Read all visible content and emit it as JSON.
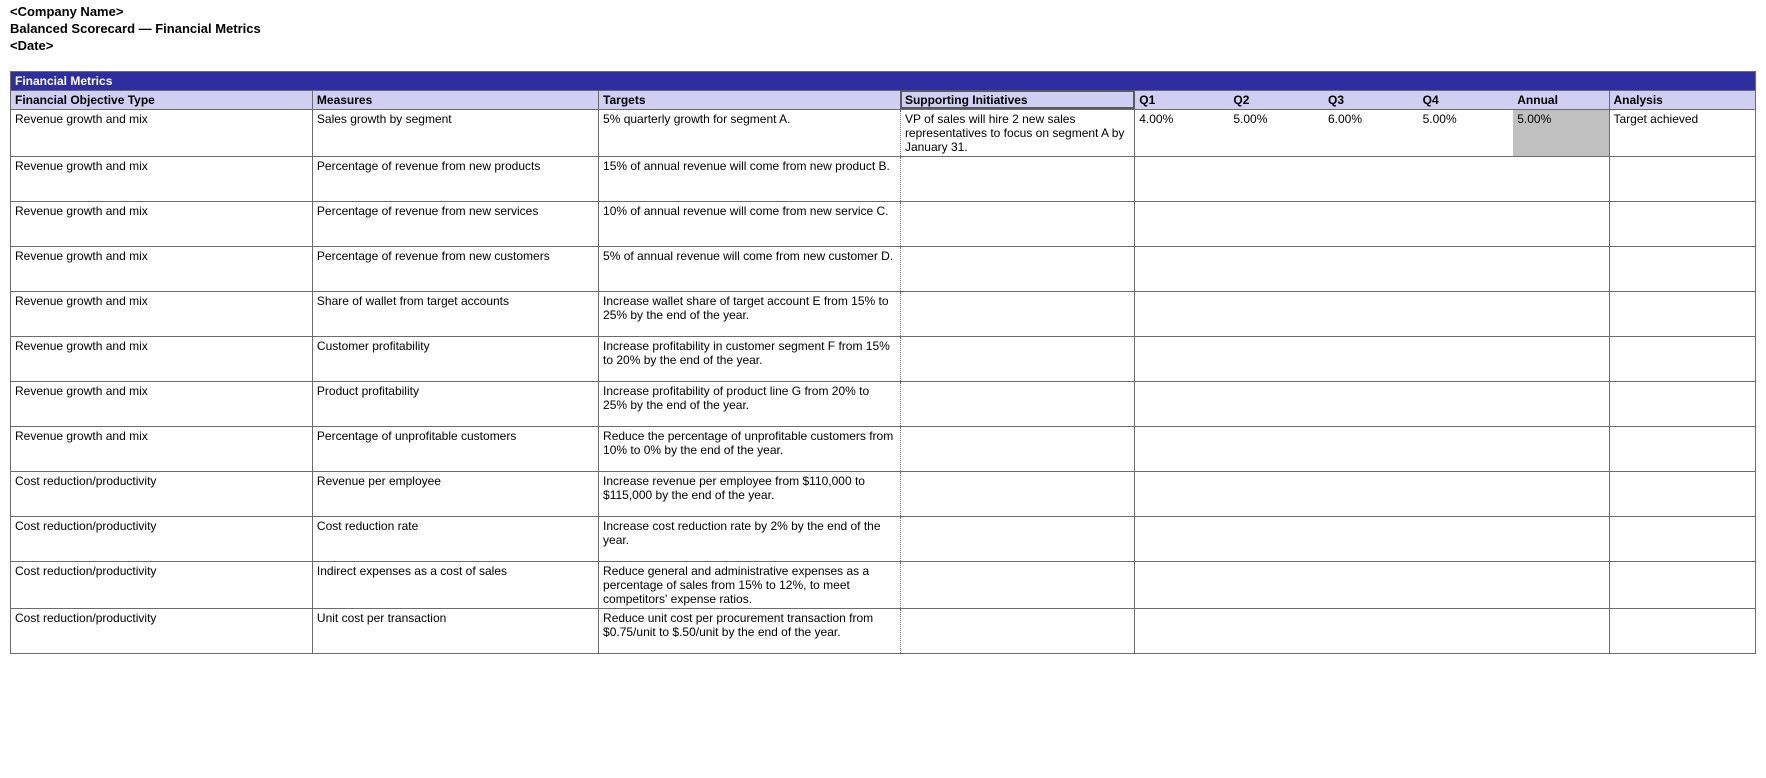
{
  "header": {
    "company": "<Company Name>",
    "title": "Balanced Scorecard — Financial Metrics",
    "date": "<Date>"
  },
  "section_title": "Financial Metrics",
  "columns": {
    "objective": "Financial Objective Type",
    "measures": "Measures",
    "targets": "Targets",
    "support": "Supporting Initiatives",
    "q1": "Q1",
    "q2": "Q2",
    "q3": "Q3",
    "q4": "Q4",
    "annual": "Annual",
    "analysis": "Analysis"
  },
  "rows": [
    {
      "objective": "Revenue growth and mix",
      "measures": "Sales growth by segment",
      "targets": "5% quarterly growth for segment A.",
      "support": "VP of sales will hire 2 new sales representatives to focus on segment A by January 31.",
      "q1": "4.00%",
      "q2": "5.00%",
      "q3": "6.00%",
      "q4": "5.00%",
      "annual": "5.00%",
      "analysis": "Target achieved",
      "annual_highlight": true
    },
    {
      "objective": "Revenue growth and mix",
      "measures": "Percentage of revenue from new products",
      "targets": "15% of annual revenue will come from new product B.",
      "support": "",
      "q1": "",
      "q2": "",
      "q3": "",
      "q4": "",
      "annual": "",
      "analysis": ""
    },
    {
      "objective": "Revenue growth and mix",
      "measures": "Percentage of revenue from new services",
      "targets": "10% of annual revenue will come from new service C.",
      "support": "",
      "q1": "",
      "q2": "",
      "q3": "",
      "q4": "",
      "annual": "",
      "analysis": ""
    },
    {
      "objective": "Revenue growth and mix",
      "measures": "Percentage of revenue from new customers",
      "targets": "5% of annual revenue will come from new customer D.",
      "support": "",
      "q1": "",
      "q2": "",
      "q3": "",
      "q4": "",
      "annual": "",
      "analysis": ""
    },
    {
      "objective": "Revenue growth and mix",
      "measures": "Share of wallet from target accounts",
      "targets": "Increase wallet share of target account E from 15% to 25% by the end of the year.",
      "support": "",
      "q1": "",
      "q2": "",
      "q3": "",
      "q4": "",
      "annual": "",
      "analysis": ""
    },
    {
      "objective": "Revenue growth and mix",
      "measures": "Customer profitability",
      "targets": "Increase profitability in customer segment F from 15% to 20% by the end of the year.",
      "support": "",
      "q1": "",
      "q2": "",
      "q3": "",
      "q4": "",
      "annual": "",
      "analysis": ""
    },
    {
      "objective": "Revenue growth and mix",
      "measures": "Product profitability",
      "targets": "Increase profitability of product line G from 20% to 25% by the end of the year.",
      "support": "",
      "q1": "",
      "q2": "",
      "q3": "",
      "q4": "",
      "annual": "",
      "analysis": ""
    },
    {
      "objective": "Revenue growth and mix",
      "measures": "Percentage of unprofitable customers",
      "targets": "Reduce the percentage of unprofitable customers from 10% to 0% by the end of the year.",
      "support": "",
      "q1": "",
      "q2": "",
      "q3": "",
      "q4": "",
      "annual": "",
      "analysis": ""
    },
    {
      "objective": "Cost reduction/productivity",
      "measures": "Revenue per employee",
      "targets": "Increase revenue per employee from $110,000 to $115,000 by the end of the year.",
      "support": "",
      "q1": "",
      "q2": "",
      "q3": "",
      "q4": "",
      "annual": "",
      "analysis": ""
    },
    {
      "objective": "Cost reduction/productivity",
      "measures": "Cost reduction rate",
      "targets": "Increase cost reduction rate by 2% by the end of the year.",
      "support": "",
      "q1": "",
      "q2": "",
      "q3": "",
      "q4": "",
      "annual": "",
      "analysis": ""
    },
    {
      "objective": "Cost reduction/productivity",
      "measures": "Indirect expenses as a cost of sales",
      "targets": "Reduce general and administrative expenses as a percentage of sales from 15% to 12%, to meet competitors' expense ratios.",
      "support": "",
      "q1": "",
      "q2": "",
      "q3": "",
      "q4": "",
      "annual": "",
      "analysis": ""
    },
    {
      "objective": "Cost reduction/productivity",
      "measures": "Unit cost per transaction",
      "targets": "Reduce unit cost per procurement transaction from $0.75/unit to $.50/unit by the end of the year.",
      "support": "",
      "q1": "",
      "q2": "",
      "q3": "",
      "q4": "",
      "annual": "",
      "analysis": ""
    }
  ]
}
